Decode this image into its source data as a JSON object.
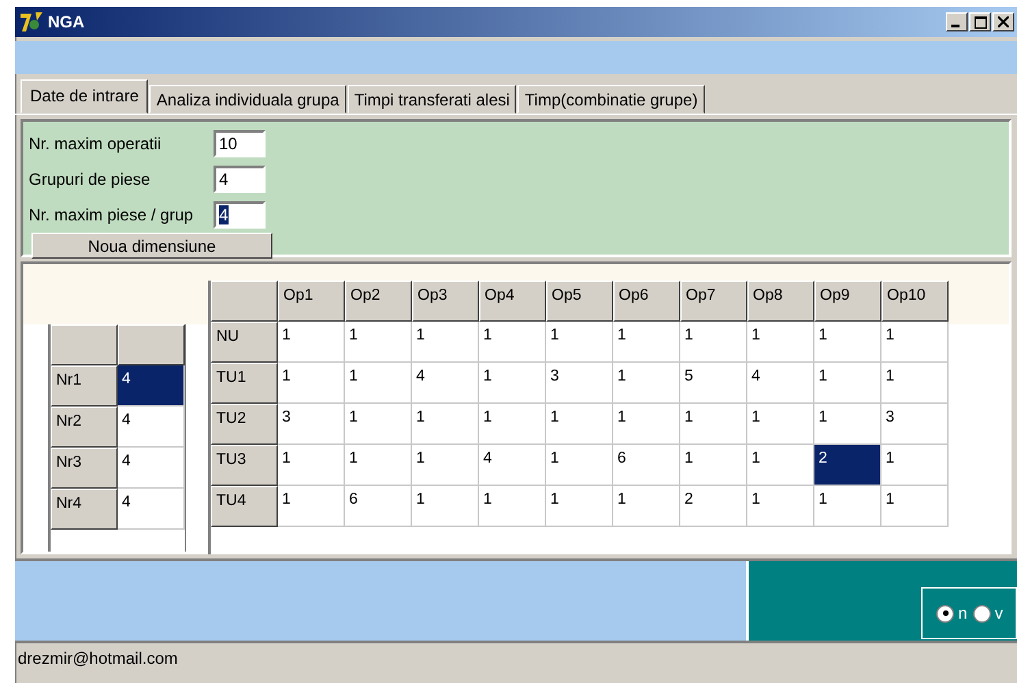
{
  "window": {
    "title": "NGA"
  },
  "tabs": [
    {
      "label": "Date de intrare",
      "selected": true
    },
    {
      "label": "Analiza individuala grupa",
      "selected": false
    },
    {
      "label": "Timpi transferati alesi",
      "selected": false
    },
    {
      "label": "Timp(combinatie grupe)",
      "selected": false
    }
  ],
  "params": [
    {
      "label": "Nr. maxim operatii",
      "value": "10",
      "selected": false
    },
    {
      "label": "Grupuri de piese",
      "value": "4",
      "selected": false
    },
    {
      "label": "Nr. maxim piese / grup",
      "value": "4",
      "selected": true
    }
  ],
  "resize_button": "Noua dimensiune",
  "groups_table": {
    "rows": [
      {
        "label": "Nr1",
        "value": "4",
        "selected": true
      },
      {
        "label": "Nr2",
        "value": "4",
        "selected": false
      },
      {
        "label": "Nr3",
        "value": "4",
        "selected": false
      },
      {
        "label": "Nr4",
        "value": "4",
        "selected": false
      }
    ]
  },
  "ops_table": {
    "columns": [
      "Op1",
      "Op2",
      "Op3",
      "Op4",
      "Op5",
      "Op6",
      "Op7",
      "Op8",
      "Op9",
      "Op10"
    ],
    "rows": [
      {
        "label": "NU",
        "cells": [
          {
            "value": "1",
            "selected": false
          },
          {
            "value": "1",
            "selected": false
          },
          {
            "value": "1",
            "selected": false
          },
          {
            "value": "1",
            "selected": false
          },
          {
            "value": "1",
            "selected": false
          },
          {
            "value": "1",
            "selected": false
          },
          {
            "value": "1",
            "selected": false
          },
          {
            "value": "1",
            "selected": false
          },
          {
            "value": "1",
            "selected": false
          },
          {
            "value": "1",
            "selected": false
          }
        ]
      },
      {
        "label": "TU1",
        "cells": [
          {
            "value": "1",
            "selected": false
          },
          {
            "value": "1",
            "selected": false
          },
          {
            "value": "4",
            "selected": false
          },
          {
            "value": "1",
            "selected": false
          },
          {
            "value": "3",
            "selected": false
          },
          {
            "value": "1",
            "selected": false
          },
          {
            "value": "5",
            "selected": false
          },
          {
            "value": "4",
            "selected": false
          },
          {
            "value": "1",
            "selected": false
          },
          {
            "value": "1",
            "selected": false
          }
        ]
      },
      {
        "label": "TU2",
        "cells": [
          {
            "value": "3",
            "selected": false
          },
          {
            "value": "1",
            "selected": false
          },
          {
            "value": "1",
            "selected": false
          },
          {
            "value": "1",
            "selected": false
          },
          {
            "value": "1",
            "selected": false
          },
          {
            "value": "1",
            "selected": false
          },
          {
            "value": "1",
            "selected": false
          },
          {
            "value": "1",
            "selected": false
          },
          {
            "value": "1",
            "selected": false
          },
          {
            "value": "3",
            "selected": false
          }
        ]
      },
      {
        "label": "TU3",
        "cells": [
          {
            "value": "1",
            "selected": false
          },
          {
            "value": "1",
            "selected": false
          },
          {
            "value": "1",
            "selected": false
          },
          {
            "value": "4",
            "selected": false
          },
          {
            "value": "1",
            "selected": false
          },
          {
            "value": "6",
            "selected": false
          },
          {
            "value": "1",
            "selected": false
          },
          {
            "value": "1",
            "selected": false
          },
          {
            "value": "2",
            "selected": true
          },
          {
            "value": "1",
            "selected": false
          }
        ]
      },
      {
        "label": "TU4",
        "cells": [
          {
            "value": "1",
            "selected": false
          },
          {
            "value": "6",
            "selected": false
          },
          {
            "value": "1",
            "selected": false
          },
          {
            "value": "1",
            "selected": false
          },
          {
            "value": "1",
            "selected": false
          },
          {
            "value": "1",
            "selected": false
          },
          {
            "value": "2",
            "selected": false
          },
          {
            "value": "1",
            "selected": false
          },
          {
            "value": "1",
            "selected": false
          },
          {
            "value": "1",
            "selected": false
          }
        ]
      }
    ]
  },
  "mode_radio": [
    {
      "label": "n",
      "selected": true
    },
    {
      "label": "v",
      "selected": false
    }
  ],
  "status_bar": "drezmir@hotmail.com"
}
